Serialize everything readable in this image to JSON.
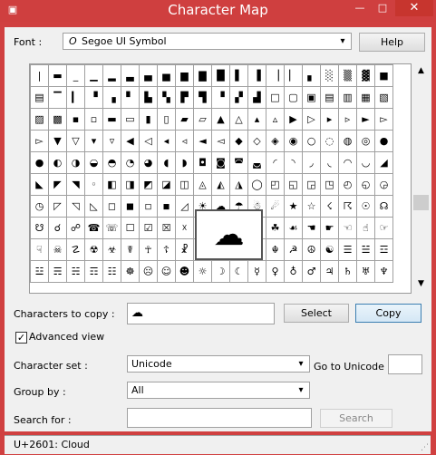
{
  "window": {
    "title": "Character Map",
    "app_icon": "charmap-icon",
    "min_label": "—",
    "max_label": "□",
    "close_label": "✕"
  },
  "font": {
    "label": "Font :",
    "selected": "Segoe UI Symbol",
    "glyph": "O"
  },
  "help_label": "Help",
  "grid": {
    "rows": [
      [
        "|",
        "▬",
        "_",
        "▁",
        "▂",
        "▃",
        "▄",
        "▅",
        "▆",
        "▇",
        "█",
        "▌",
        "▐",
        "▕",
        "▏",
        "▖",
        "░",
        "▒",
        "▓",
        "■"
      ],
      [
        "▤",
        "▔",
        "▎",
        "▝",
        "▗",
        "▘",
        "▙",
        "▚",
        "▛",
        "▜",
        "▝",
        "▞",
        "▟",
        "□",
        "▢",
        "▣",
        "▤",
        "▥",
        "▦",
        "▧"
      ],
      [
        "▨",
        "▩",
        "▪",
        "▫",
        "▬",
        "▭",
        "▮",
        "▯",
        "▰",
        "▱",
        "▲",
        "△",
        "▴",
        "▵",
        "▶",
        "▷",
        "▸",
        "▹",
        "►",
        "▻"
      ],
      [
        "▻",
        "▼",
        "▽",
        "▾",
        "▿",
        "◀",
        "◁",
        "◂",
        "◃",
        "◄",
        "◅",
        "◆",
        "◇",
        "◈",
        "◉",
        "○",
        "◌",
        "◍",
        "◎",
        "●"
      ],
      [
        "●",
        "◐",
        "◑",
        "◒",
        "◓",
        "◔",
        "◕",
        "◖",
        "◗",
        "◘",
        "◙",
        "◚",
        "◛",
        "◜",
        "◝",
        "◞",
        "◟",
        "◠",
        "◡",
        "◢"
      ],
      [
        "◣",
        "◤",
        "◥",
        "◦",
        "◧",
        "◨",
        "◩",
        "◪",
        "◫",
        "◬",
        "◭",
        "◮",
        "◯",
        "◰",
        "◱",
        "◲",
        "◳",
        "◴",
        "◵",
        "◶"
      ],
      [
        "◷",
        "◸",
        "◹",
        "◺",
        "◻",
        "◼",
        "◽",
        "◾",
        "◿",
        "☀",
        "☁",
        "☂",
        "☃",
        "☄",
        "★",
        "☆",
        "☇",
        "☈",
        "☉",
        "☊"
      ],
      [
        "☋",
        "☌",
        "☍",
        "☎",
        "☏",
        "☐",
        "☑",
        "☒",
        "☓",
        "☔",
        "☕",
        "☖",
        "☗",
        "☘",
        "☙",
        "☚",
        "☛",
        "☜",
        "☝",
        "☞"
      ],
      [
        "☟",
        "☠",
        "☡",
        "☢",
        "☣",
        "☤",
        "☥",
        "☦",
        "☧",
        "☨",
        "☩",
        "☪",
        "☫",
        "☬",
        "☭",
        "☮",
        "☯",
        "☰",
        "☱",
        "☲"
      ],
      [
        "☳",
        "☴",
        "☵",
        "☶",
        "☷",
        "☸",
        "☹",
        "☺",
        "☻",
        "☼",
        "☽",
        "☾",
        "☿",
        "♀",
        "♁",
        "♂",
        "♃",
        "♄",
        "♅",
        "♆"
      ]
    ]
  },
  "zoom_char": "☁",
  "copy_row": {
    "label": "Characters to copy :",
    "value": "☁",
    "select_label": "Select",
    "copy_label": "Copy"
  },
  "advanced": {
    "label": "Advanced view",
    "checked": "✓"
  },
  "charset": {
    "label": "Character set :",
    "selected": "Unicode",
    "goto_label": "Go to Unicode :",
    "goto_value": ""
  },
  "groupby": {
    "label": "Group by :",
    "selected": "All"
  },
  "search": {
    "label": "Search for :",
    "value": "",
    "button": "Search"
  },
  "status": "U+2601: Cloud",
  "scroll": {
    "up": "▲",
    "down": "▼"
  }
}
